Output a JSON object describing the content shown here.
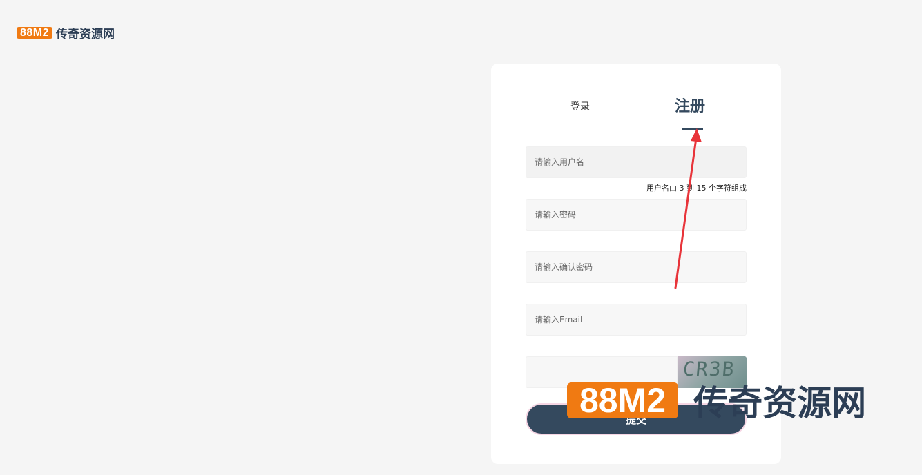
{
  "logo": {
    "badge": "88M2",
    "text": "传奇资源网"
  },
  "tabs": {
    "login": "登录",
    "register": "注册",
    "active": "register"
  },
  "form": {
    "username_placeholder": "请输入用户名",
    "username_hint": "用户名由 3 到 15 个字符组成",
    "password_placeholder": "请输入密码",
    "confirm_placeholder": "请输入确认密码",
    "email_placeholder": "请输入Email",
    "captcha_placeholder": "",
    "captcha_text": "CR3B",
    "submit_label": "提交"
  },
  "watermark": {
    "badge": "88M2",
    "text": "传奇资源网"
  },
  "colors": {
    "accent": "#f07a12",
    "primary": "#34495e",
    "arrow": "#e8343a"
  }
}
